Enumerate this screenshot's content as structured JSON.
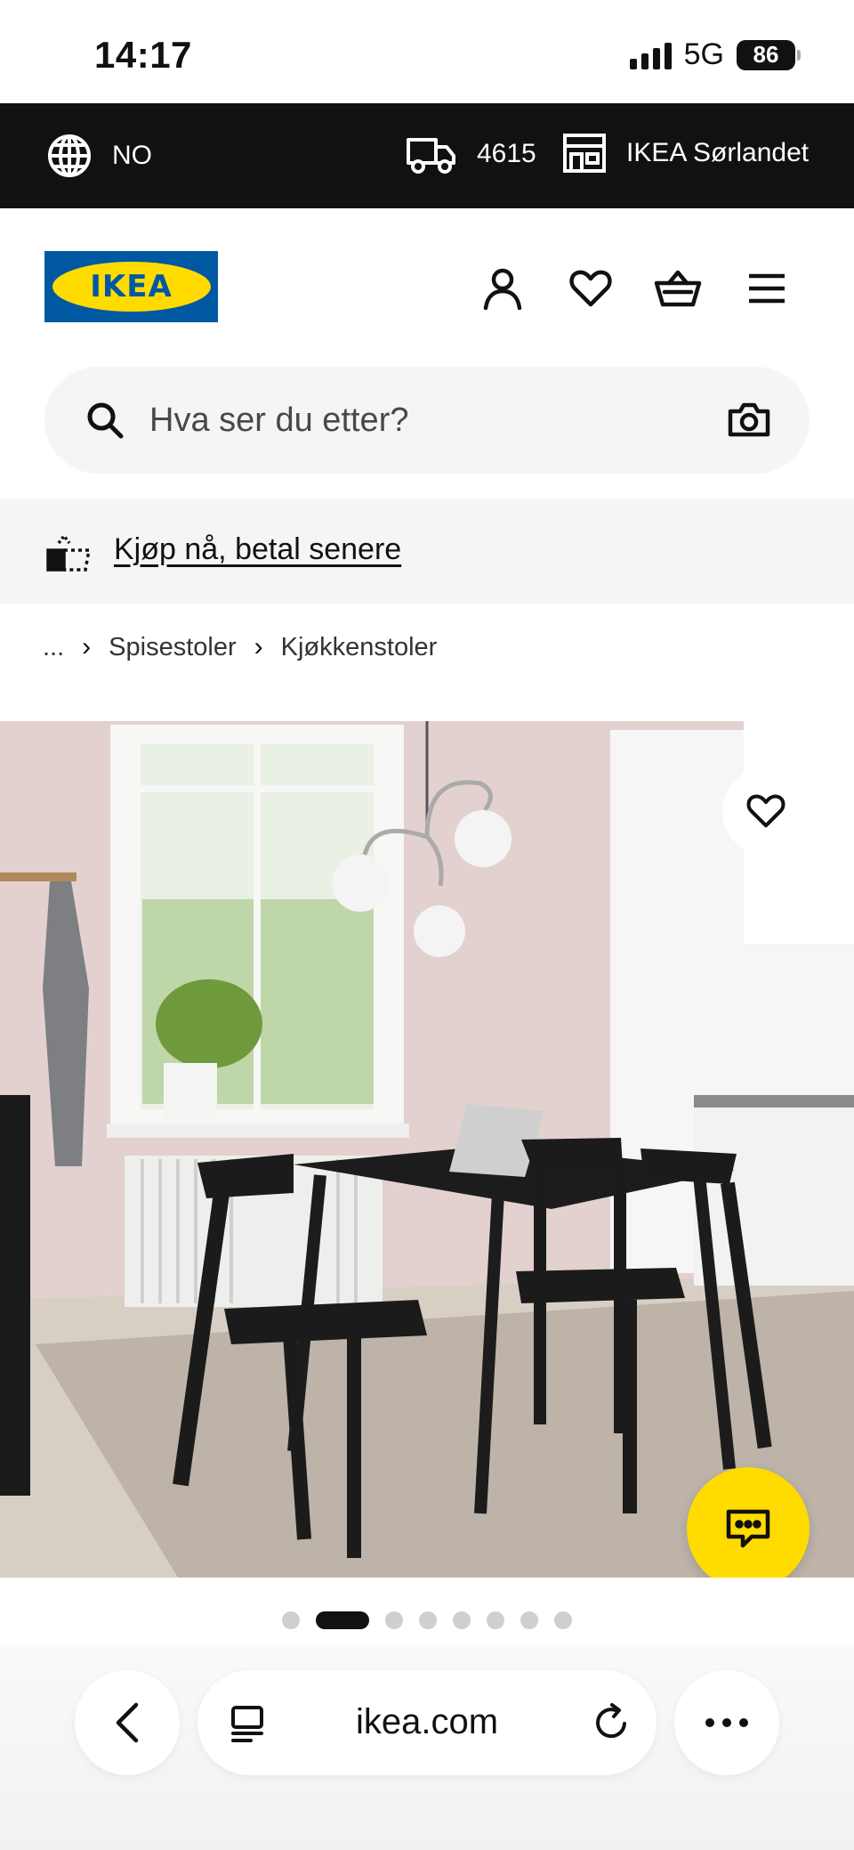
{
  "status_bar": {
    "time": "14:17",
    "network": "5G",
    "battery": "86"
  },
  "top_bar": {
    "language": "NO",
    "postcode": "4615",
    "store": "IKEA Sørlandet"
  },
  "header": {
    "logo_text": "IKEA"
  },
  "search": {
    "placeholder": "Hva ser du etter?"
  },
  "promo": {
    "link_text": "Kjøp nå, betal senere"
  },
  "breadcrumb": {
    "ellipsis": "...",
    "items": [
      "Spisestoler",
      "Kjøkkenstoler"
    ]
  },
  "carousel": {
    "total_dots": 8,
    "active_index": 1
  },
  "browser": {
    "url": "ikea.com"
  },
  "colors": {
    "ikea_blue": "#0058a3",
    "ikea_yellow": "#ffdb00",
    "top_bar_bg": "#111111",
    "search_bg": "#f5f5f5"
  },
  "icons": [
    "globe-icon",
    "truck-icon",
    "store-icon",
    "account-icon",
    "heart-icon",
    "basket-icon",
    "menu-icon",
    "search-icon",
    "camera-icon",
    "pay-later-icon",
    "chat-icon",
    "back-icon",
    "tabs-icon",
    "reload-icon",
    "more-icon"
  ]
}
